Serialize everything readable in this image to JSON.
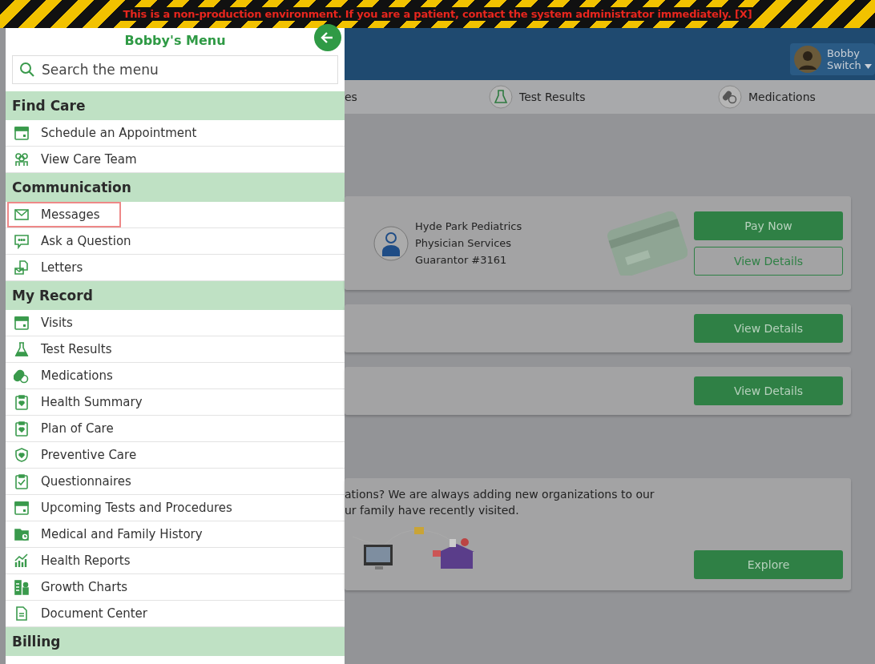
{
  "banner": {
    "text": "This is a non-production environment. If you are a patient, contact the system administrator immediately. [X]"
  },
  "menu": {
    "title": "Bobby's Menu",
    "search": {
      "placeholder": "Search the menu"
    },
    "sections": [
      {
        "heading": "Find Care",
        "items": [
          {
            "label": "Schedule an Appointment",
            "kind": "calendar",
            "outlined": false
          },
          {
            "label": "View Care Team",
            "kind": "team",
            "outlined": false
          }
        ]
      },
      {
        "heading": "Communication",
        "items": [
          {
            "label": "Messages",
            "kind": "envelope",
            "outlined": true
          },
          {
            "label": "Ask a Question",
            "kind": "chat",
            "outlined": false
          },
          {
            "label": "Letters",
            "kind": "letter",
            "outlined": false
          }
        ]
      },
      {
        "heading": "My Record",
        "items": [
          {
            "label": "Visits",
            "kind": "calendar",
            "outlined": false
          },
          {
            "label": "Test Results",
            "kind": "flask",
            "outlined": false
          },
          {
            "label": "Medications",
            "kind": "pills",
            "outlined": false
          },
          {
            "label": "Health Summary",
            "kind": "clipboard",
            "outlined": false
          },
          {
            "label": "Plan of Care",
            "kind": "clipboard",
            "outlined": false
          },
          {
            "label": "Preventive Care",
            "kind": "shield",
            "outlined": false
          },
          {
            "label": "Questionnaires",
            "kind": "checklist",
            "outlined": false
          },
          {
            "label": "Upcoming Tests and Procedures",
            "kind": "calendar",
            "outlined": false
          },
          {
            "label": "Medical and Family History",
            "kind": "folder",
            "outlined": false
          },
          {
            "label": "Health Reports",
            "kind": "chart",
            "outlined": false
          },
          {
            "label": "Growth Charts",
            "kind": "growth",
            "outlined": false
          },
          {
            "label": "Document Center",
            "kind": "document",
            "outlined": false
          }
        ]
      },
      {
        "heading": "Billing"
      }
    ]
  },
  "header": {
    "user_name": "Bobby",
    "switch_label": "Switch"
  },
  "tabs": [
    {
      "label": "es",
      "kind": "plain"
    },
    {
      "label": "Test Results",
      "kind": "flask"
    },
    {
      "label": "Medications",
      "kind": "pills"
    }
  ],
  "cards": [
    {
      "kind": "account",
      "lines": [
        "Hyde Park Pediatrics",
        "Physician Services",
        "Guarantor #3161"
      ],
      "buttons": [
        {
          "label": "Pay Now",
          "kind": "filled"
        },
        {
          "label": "View Details",
          "kind": "outline"
        }
      ]
    },
    {
      "kind": "plain",
      "buttons": [
        {
          "label": "View Details",
          "kind": "filled"
        }
      ]
    },
    {
      "kind": "plain",
      "buttons": [
        {
          "label": "View Details",
          "kind": "filled"
        }
      ]
    },
    {
      "kind": "promo",
      "text": [
        "ations? We are always adding new organizations to our",
        "ur family have recently visited."
      ],
      "buttons": [
        {
          "label": "Explore",
          "kind": "filled"
        }
      ]
    }
  ]
}
